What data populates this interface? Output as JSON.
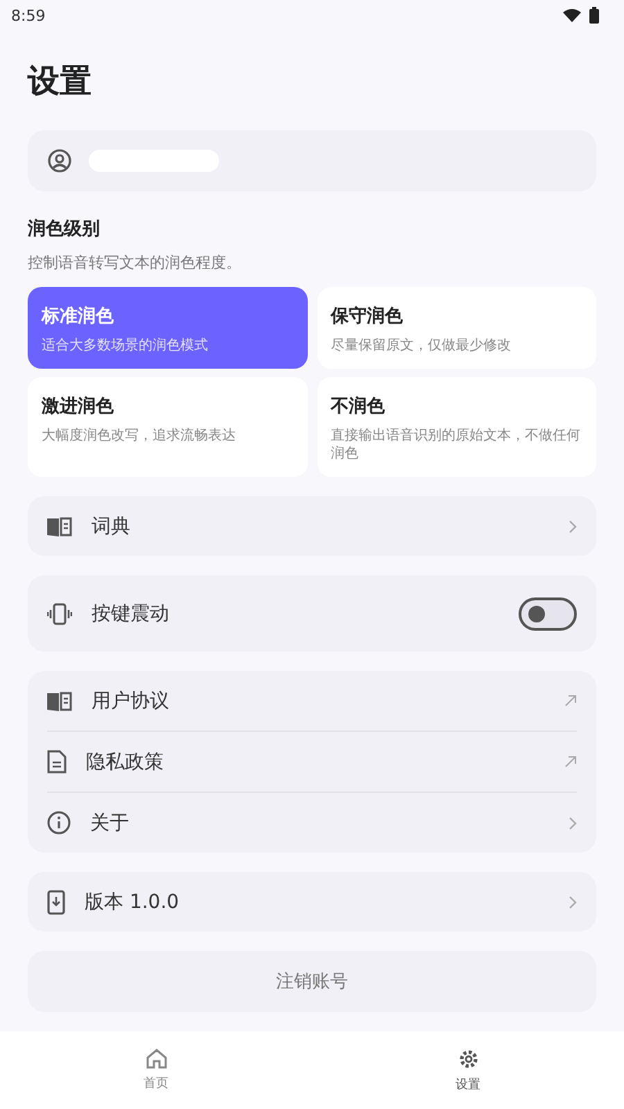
{
  "status_bar": {
    "time": "8:59"
  },
  "title": "设置",
  "profile": {
    "name_hidden": true
  },
  "polish": {
    "title": "润色级别",
    "subtitle": "控制语音转写文本的润色程度。",
    "options": [
      {
        "label": "标准润色",
        "desc": "适合大多数场景的润色模式",
        "selected": true
      },
      {
        "label": "保守润色",
        "desc": "尽量保留原文，仅做最少修改",
        "selected": false
      },
      {
        "label": "激进润色",
        "desc": "大幅度润色改写，追求流畅表达",
        "selected": false
      },
      {
        "label": "不润色",
        "desc": "直接输出语音识别的原始文本，不做任何润色",
        "selected": false
      }
    ]
  },
  "groups": [
    [
      {
        "kind": "link",
        "label": "词典"
      }
    ],
    [
      {
        "kind": "switch",
        "label": "按键震动",
        "on": false
      }
    ],
    [
      {
        "kind": "external",
        "label": "用户协议"
      },
      {
        "kind": "external",
        "label": "隐私政策"
      },
      {
        "kind": "link",
        "label": "关于"
      }
    ],
    [
      {
        "kind": "link",
        "label": "版本 1.0.0"
      }
    ]
  ],
  "logout": "注销账号",
  "nav": [
    {
      "label": "首页",
      "selected": false
    },
    {
      "label": "设置",
      "selected": true
    }
  ]
}
